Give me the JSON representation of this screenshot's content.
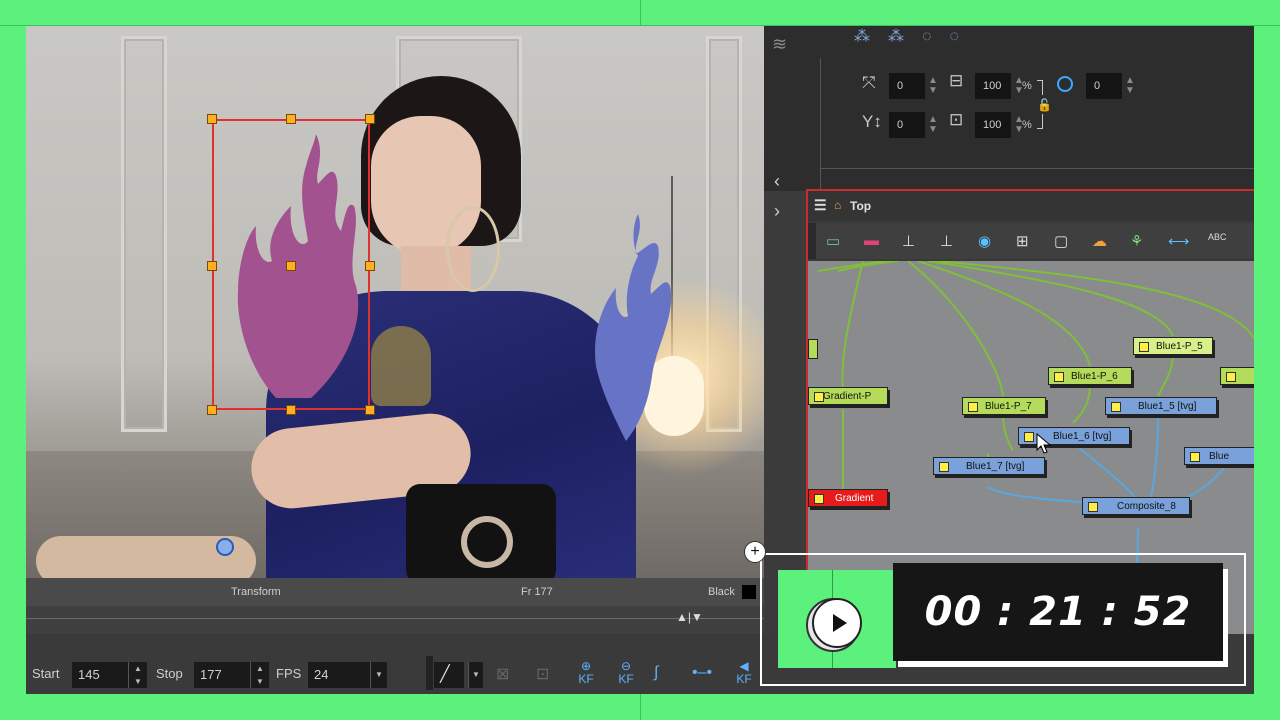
{
  "viewer": {
    "status_left": "Transform",
    "status_frame": "Fr 177",
    "status_bg": "Black"
  },
  "tool_options": {
    "x_value": "0",
    "y_value": "0",
    "width_value": "100",
    "height_value": "100",
    "angle_value": "0",
    "percent_symbol": "%"
  },
  "node_view": {
    "breadcrumb": "Top",
    "nodes": {
      "gradient_p": "Gradient-P",
      "gradient": "Gradient",
      "blue1_p_5": "Blue1-P_5",
      "blue1_p_6": "Blue1-P_6",
      "blue1_p_7": "Blue1-P_7",
      "blue1_5": "Blue1_5 [tvg]",
      "blue1_6": "Blue1_6 [tvg]",
      "blue1_7": "Blue1_7 [tvg]",
      "composite_8": "Composite_8",
      "blue_partial": "Blue"
    },
    "toolbar_icons": [
      "display-icon",
      "matte-icon",
      "peg-icon",
      "group-icon",
      "composite-icon",
      "network-icon",
      "export-icon",
      "cloud-icon",
      "tree-icon",
      "connect-icon",
      "text-abc-icon"
    ]
  },
  "bottom": {
    "start_label": "Start",
    "start_value": "145",
    "stop_label": "Stop",
    "stop_value": "177",
    "fps_label": "FPS",
    "fps_value": "24",
    "kf_label": "KF"
  },
  "overlay": {
    "timecode": "00 : 21 : 52"
  },
  "colors": {
    "frame_green": "#5cf07c",
    "selection_red": "#e03030",
    "flame_purple": "#a2528f",
    "flame_blue": "#6774c6",
    "node_green": "#b5db5a",
    "node_blue": "#7aa1da",
    "node_red": "#e61b1b"
  }
}
